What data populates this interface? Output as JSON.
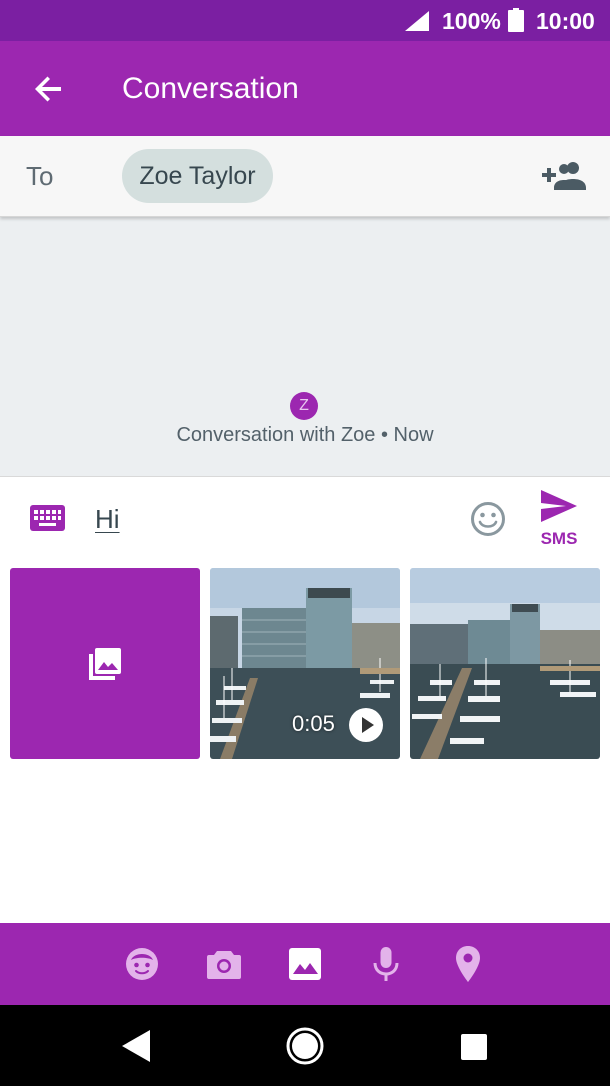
{
  "status_bar": {
    "battery_percent": "100%",
    "time": "10:00"
  },
  "app_bar": {
    "title": "Conversation",
    "back_icon": "arrow-back-icon"
  },
  "recipient": {
    "to_label": "To",
    "chip_name": "Zoe Taylor",
    "add_icon": "add-people-icon"
  },
  "conversation": {
    "avatar_letter": "Z",
    "info_text": "Conversation with Zoe • Now"
  },
  "compose": {
    "message_text": "Hi",
    "send_label": "SMS"
  },
  "media": {
    "video_duration": "0:05",
    "tiles": [
      "gallery-tile",
      "video-thumbnail",
      "photo-thumbnail"
    ]
  },
  "attachments": {
    "icons": [
      "sticker-icon",
      "camera-icon",
      "image-icon",
      "microphone-icon",
      "location-icon"
    ],
    "selected": "image-icon"
  },
  "colors": {
    "primary": "#9c27b0",
    "primary_dark": "#7b1fa2",
    "chip": "#d4dfde",
    "conversation_bg": "#eceff1"
  }
}
